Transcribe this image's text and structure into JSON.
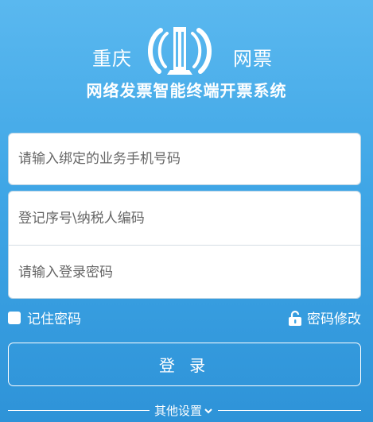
{
  "header": {
    "city_left": "重庆",
    "city_right": "网票",
    "system_title": "网络发票智能终端开票系统"
  },
  "form": {
    "phone_placeholder": "请输入绑定的业务手机号码",
    "taxpayer_placeholder": "登记序号\\纳税人编码",
    "password_placeholder": "请输入登录密码"
  },
  "options": {
    "remember_label": "记住密码",
    "remember_checked": false,
    "change_password_label": "密码修改"
  },
  "login_label": "登 录",
  "other_settings_label": "其他设置",
  "icons": {
    "emblem": "tax-emblem-icon",
    "lock": "unlock-icon",
    "chevron": "chevron-down-icon"
  },
  "colors": {
    "background_top": "#5ab8ef",
    "background_bottom": "#2e93d8",
    "text": "#ffffff"
  }
}
